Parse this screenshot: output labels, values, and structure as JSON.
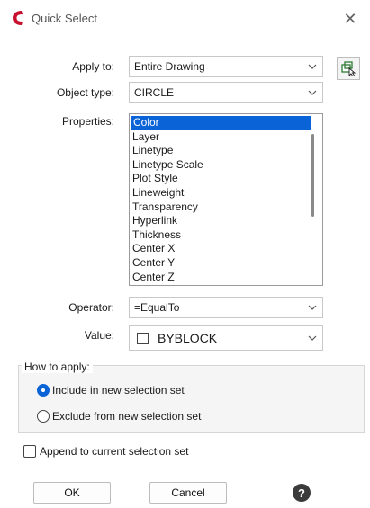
{
  "window": {
    "title": "Quick Select",
    "close_glyph": "✕",
    "accent_color": "#0a64d8",
    "logo_color": "#c8102e"
  },
  "form": {
    "apply_to": {
      "label": "Apply to:",
      "value": "Entire Drawing",
      "picker_icon": "select-objects-icon"
    },
    "object_type": {
      "label": "Object type:",
      "value": "CIRCLE"
    },
    "properties": {
      "label": "Properties:",
      "items": [
        "Color",
        "Layer",
        "Linetype",
        "Linetype Scale",
        "Plot Style",
        "Lineweight",
        "Transparency",
        "Hyperlink",
        "Thickness",
        "Center X",
        "Center Y",
        "Center Z"
      ],
      "selected": "Color"
    },
    "operator": {
      "label": "Operator:",
      "value": "=EqualTo"
    },
    "value": {
      "label": "Value:",
      "value": "BYBLOCK"
    }
  },
  "how_to_apply": {
    "title": "How to apply:",
    "options": [
      {
        "label": "Include in new selection set",
        "checked": true
      },
      {
        "label": "Exclude from new selection set",
        "checked": false
      }
    ]
  },
  "append": {
    "label": "Append to current selection set",
    "checked": false
  },
  "buttons": {
    "ok": "OK",
    "cancel": "Cancel",
    "help": "?"
  }
}
